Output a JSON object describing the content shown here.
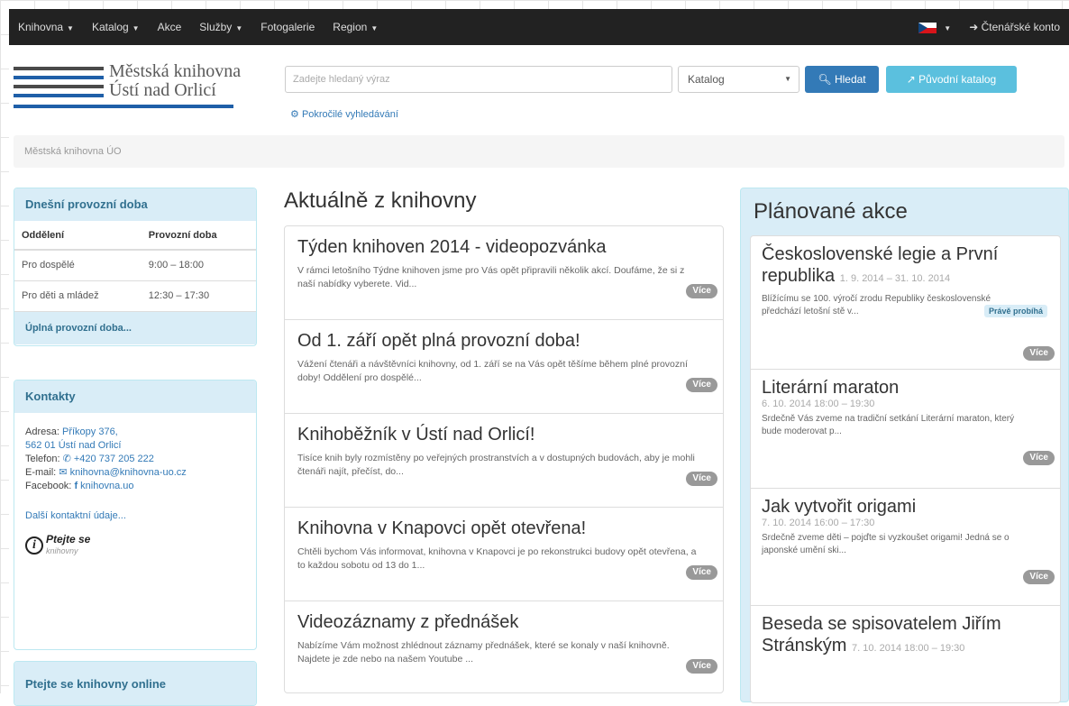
{
  "nav": {
    "items": [
      {
        "label": "Knihovna",
        "caret": true
      },
      {
        "label": "Katalog",
        "caret": true
      },
      {
        "label": "Akce",
        "caret": false
      },
      {
        "label": "Služby",
        "caret": true
      },
      {
        "label": "Fotogalerie",
        "caret": false
      },
      {
        "label": "Region",
        "caret": true
      }
    ],
    "account_label": "Čtenářské konto",
    "language_icon": "czech-flag"
  },
  "logo": {
    "line1": "Městská knihovna",
    "line2": "Ústí nad Orlicí"
  },
  "search": {
    "placeholder": "Zadejte hledaný výraz",
    "select_value": "Katalog",
    "search_button": "Hledat",
    "catalog_button": "Původní katalog",
    "advanced_link": "Pokročilé vyhledávání"
  },
  "breadcrumb": "Městská knihovna ÚO",
  "hours": {
    "title": "Dnešní provozní doba",
    "col1": "Oddělení",
    "col2": "Provozní doba",
    "rows": [
      {
        "dept": "Pro dospělé",
        "time": "9:00 – 18:00"
      },
      {
        "dept": "Pro děti a mládež",
        "time": "12:30 – 17:30"
      }
    ],
    "footer": "Úplná provozní doba..."
  },
  "contacts": {
    "title": "Kontakty",
    "address_label": "Adresa:",
    "address_line1": "Příkopy 376,",
    "address_line2": "562 01 Ústí nad Orlicí",
    "phone_label": "Telefon:",
    "phone": "+420 737 205 222",
    "email_label": "E-mail:",
    "email": "knihovna@knihovna-uo.cz",
    "facebook_label": "Facebook:",
    "facebook": "knihovna.uo",
    "more": "Další kontaktní údaje...",
    "ptejte_title": "Ptejte se",
    "ptejte_sub": "knihovny"
  },
  "online": {
    "title": "Ptejte se knihovny online"
  },
  "news": {
    "title": "Aktuálně z knihovny",
    "more_label": "Více",
    "items": [
      {
        "title": "Týden knihoven 2014 - videopozvánka",
        "text": "V rámci letošního Týdne knihoven jsme pro Vás opět připravili několik akcí. Doufáme, že si z naší nabídky vyberete. Vid..."
      },
      {
        "title": "Od 1. září opět plná provozní doba!",
        "text": "Vážení čtenáři a návštěvníci knihovny, od 1. září se na Vás opět těšíme během plné provozní doby! Oddělení pro dospělé..."
      },
      {
        "title": "Knihoběžník v Ústí nad Orlicí!",
        "text": "Tisíce knih byly rozmístěny po veřejných prostranstvích a v dostupných budovách, aby je mohli čtenáři najít, přečíst, do..."
      },
      {
        "title": "Knihovna v Knapovci opět otevřena!",
        "text": "Chtěli bychom Vás informovat, knihovna v Knapovci je po rekonstrukci budovy opět otevřena, a to každou sobotu od 13 do 1..."
      },
      {
        "title": "Videozáznamy z přednášek",
        "text": "Nabízíme Vám možnost zhlédnout záznamy přednášek, které se konaly v naší knihovně. Najdete je zde nebo na našem Youtube ..."
      }
    ]
  },
  "events": {
    "title": "Plánované akce",
    "more_label": "Více",
    "now_label": "Právě probíhá",
    "items": [
      {
        "title": "Československé legie a První republika",
        "date": "1. 9. 2014 – 31. 10. 2014",
        "desc": "Blížícímu se 100. výročí zrodu Republiky československé předchází letošní stě v..."
      },
      {
        "title": "Literární maraton",
        "date": "6. 10. 2014 18:00 – 19:30",
        "desc": "Srdečně Vás zveme na tradiční setkání Literární maraton, který bude moderovat p..."
      },
      {
        "title": "Jak vytvořit origami",
        "date": "7. 10. 2014 16:00 – 17:30",
        "desc": "Srdečně zveme děti – pojďte si vyzkoušet origami! Jedná se o japonské umění ski..."
      },
      {
        "title": "Beseda se spisovatelem Jiřím Stránským",
        "date": "7. 10. 2014 18:00 – 19:30",
        "desc": ""
      }
    ]
  }
}
